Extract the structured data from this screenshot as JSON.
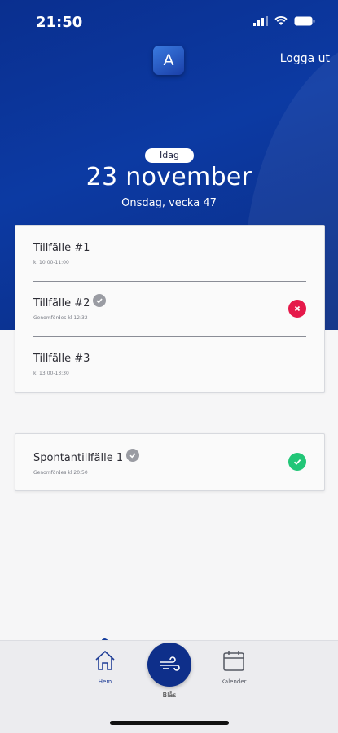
{
  "status_bar": {
    "time": "21:50"
  },
  "header": {
    "logo_letter": "A",
    "logout_label": "Logga ut"
  },
  "today": {
    "pill": "Idag",
    "date": "23 november",
    "weekday_week": "Onsdag, vecka 47"
  },
  "sessions": [
    {
      "title": "Tillfälle #1",
      "subtitle": "kl 10:00-11:00",
      "verified": false,
      "status": "none"
    },
    {
      "title": "Tillfälle #2",
      "subtitle": "Genomfördes kl 12:32",
      "verified": true,
      "status": "failed"
    },
    {
      "title": "Tillfälle #3",
      "subtitle": "kl 13:00-13:30",
      "verified": false,
      "status": "none"
    }
  ],
  "spontaneous": {
    "title": "Spontantillfälle 1",
    "subtitle": "Genomfördes kl 20:50",
    "verified": true,
    "status": "passed"
  },
  "tabbar": {
    "home_label": "Hem",
    "blow_label": "Blås",
    "calendar_label": "Kalender"
  },
  "colors": {
    "brand": "#0c3aa3",
    "fail": "#e5194a",
    "ok": "#22c677"
  },
  "icons": {
    "home": "home-icon",
    "blow": "wind-icon",
    "calendar": "calendar-icon",
    "verified": "verified-check-icon",
    "failed": "close-icon",
    "passed": "check-icon"
  }
}
